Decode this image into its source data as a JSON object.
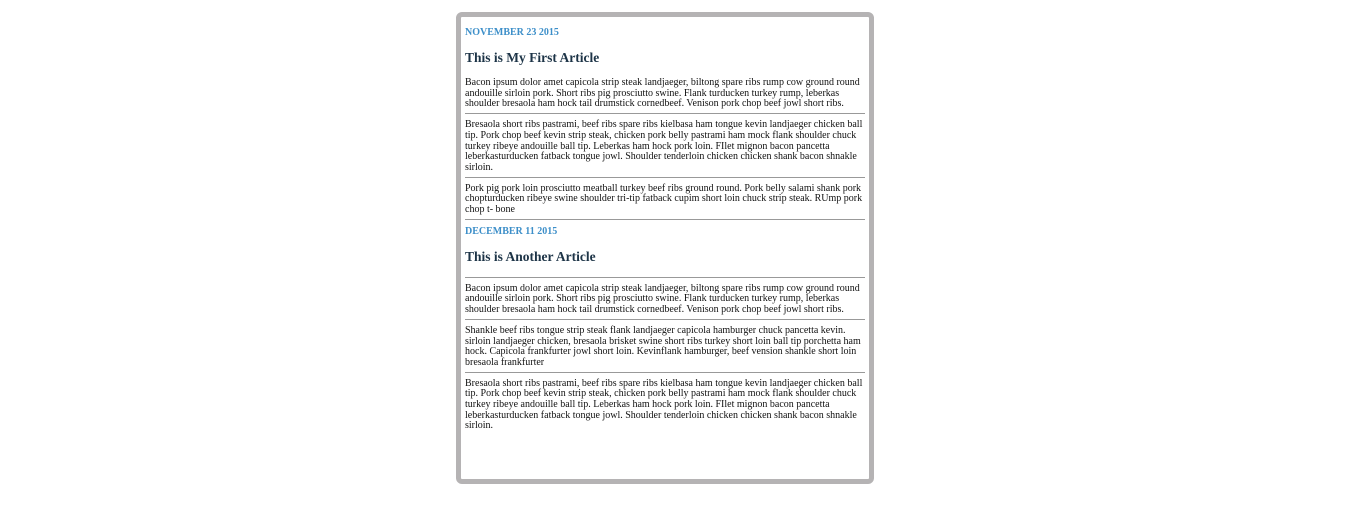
{
  "articles": [
    {
      "date": "NOVEMBER 23 2015",
      "title": "This is My First Article",
      "paragraphs": [
        "Bacon ipsum dolor amet capicola strip steak landjaeger, biltong spare ribs rump cow ground round andouille sirloin pork. Short ribs pig prosciutto swine. Flank turducken turkey rump, leberkas shoulder bresaola ham hock tail drumstick cornedbeef. Venison pork chop beef jowl short ribs.",
        "Bresaola short ribs pastrami, beef ribs spare ribs kielbasa ham tongue kevin landjaeger chicken ball tip. Pork chop beef kevin strip steak, chicken pork belly pastrami ham mock flank shoulder chuck turkey ribeye andouille ball tip. Leberkas ham hock pork loin. FIlet mignon bacon pancetta leberkasturducken fatback tongue jowl. Shoulder tenderloin chicken chicken shank bacon shnakle sirloin.",
        "Pork pig pork loin prosciutto meatball turkey beef ribs ground round. Pork belly salami shank pork chopturducken ribeye swine shoulder tri-tip fatback cupim short loin chuck strip steak. RUmp pork chop t- bone"
      ]
    },
    {
      "date": "DECEMBER 11 2015",
      "title": "This is Another Article",
      "paragraphs": [
        "Bacon ipsum dolor amet capicola strip steak landjaeger, biltong spare ribs rump cow ground round andouille sirloin pork. Short ribs pig prosciutto swine. Flank turducken turkey rump, leberkas shoulder bresaola ham hock tail drumstick cornedbeef. Venison pork chop beef jowl short ribs.",
        "Shankle beef ribs tongue strip steak flank landjaeger capicola hamburger chuck pancetta kevin. sirloin landjaeger chicken, bresaola brisket swine short ribs turkey short loin ball tip porchetta ham hock. Capicola frankfurter jowl short loin. Kevinflank hamburger, beef vension shankle short loin bresaola frankfurter",
        "Bresaola short ribs pastrami, beef ribs spare ribs kielbasa ham tongue kevin landjaeger chicken ball tip. Pork chop beef kevin strip steak, chicken pork belly pastrami ham mock flank shoulder chuck turkey ribeye andouille ball tip. Leberkas ham hock pork loin. FIlet mignon bacon pancetta leberkasturducken fatback tongue jowl. Shoulder tenderloin chicken chicken shank bacon shnakle sirloin."
      ]
    }
  ],
  "colors": {
    "date": "#3d8fc9",
    "title": "#1d3447",
    "frame_border": "#b5b3b4",
    "rule": "#999999"
  }
}
